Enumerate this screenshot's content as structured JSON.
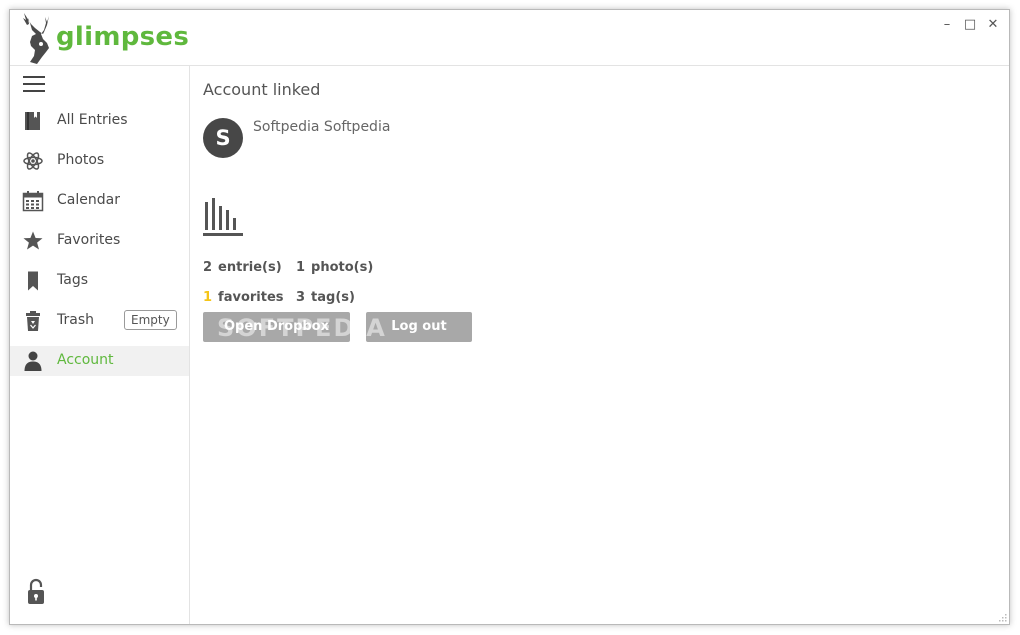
{
  "app": {
    "name": "glimpses",
    "brand_color": "#5fb83d"
  },
  "window_controls": {
    "minimize": "–",
    "maximize": "□",
    "close": "✕"
  },
  "sidebar": {
    "items": [
      {
        "label": "All Entries",
        "icon": "book-icon"
      },
      {
        "label": "Photos",
        "icon": "atom-icon"
      },
      {
        "label": "Calendar",
        "icon": "calendar-icon"
      },
      {
        "label": "Favorites",
        "icon": "star-icon"
      },
      {
        "label": "Tags",
        "icon": "bookmark-icon"
      },
      {
        "label": "Trash",
        "icon": "trash-icon",
        "action_label": "Empty"
      },
      {
        "label": "Account",
        "icon": "user-icon",
        "active": true
      }
    ]
  },
  "account": {
    "heading": "Account linked",
    "avatar_letter": "S",
    "username": "Softpedia Softpedia",
    "stats": {
      "entries": {
        "count": "2",
        "label": "entrie(s)"
      },
      "photos": {
        "count": "1",
        "label": "photo(s)"
      },
      "favorites": {
        "count": "1",
        "label": "favorites",
        "color": "#f5c518"
      },
      "tags": {
        "count": "3",
        "label": "tag(s)"
      }
    },
    "buttons": {
      "open_dropbox": "Open Dropbox",
      "log_out": "Log out"
    },
    "watermark": "SOFTPEDIA"
  }
}
